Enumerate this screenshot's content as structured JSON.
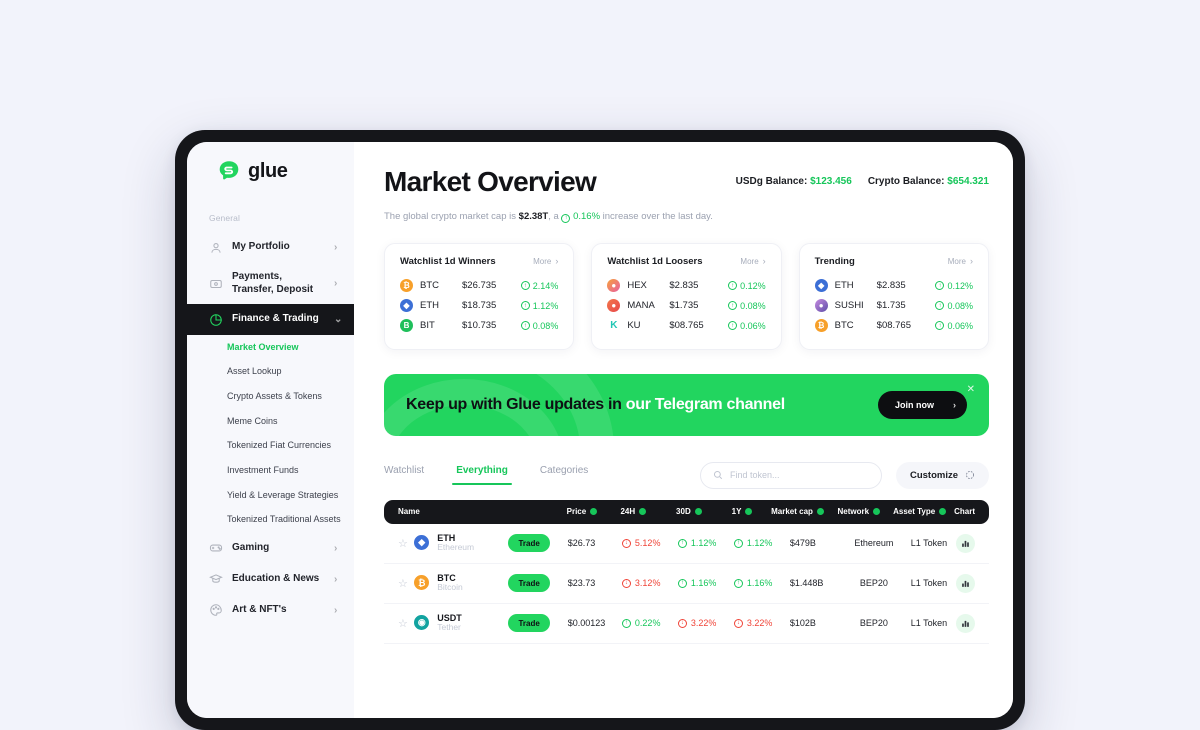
{
  "brand": {
    "name": "glue",
    "logo_icon": "glue-logo-icon"
  },
  "sidebar": {
    "section_label": "General",
    "items": [
      {
        "label": "My Portfolio",
        "icon": "user-icon",
        "chevron": "›",
        "active": false
      },
      {
        "label": "Payments, Transfer, Deposit",
        "icon": "wallet-icon",
        "chevron": "›",
        "active": false
      },
      {
        "label": "Finance & Trading",
        "icon": "pie-chart-icon",
        "chevron": "⌄",
        "active": true
      },
      {
        "label": "Gaming",
        "icon": "gamepad-icon",
        "chevron": "›",
        "active": false
      },
      {
        "label": "Education & News",
        "icon": "graduation-cap-icon",
        "chevron": "›",
        "active": false
      },
      {
        "label": "Art & NFT's",
        "icon": "palette-icon",
        "chevron": "›",
        "active": false
      }
    ],
    "sub_items": [
      {
        "label": "Market Overview",
        "current": true
      },
      {
        "label": "Asset Lookup",
        "current": false
      },
      {
        "label": "Crypto Assets & Tokens",
        "current": false
      },
      {
        "label": "Meme Coins",
        "current": false
      },
      {
        "label": "Tokenized Fiat Currencies",
        "current": false
      },
      {
        "label": "Investment Funds",
        "current": false
      },
      {
        "label": "Yield & Leverage Strategies",
        "current": false
      },
      {
        "label": "Tokenized Traditional Assets",
        "current": false
      }
    ]
  },
  "header": {
    "title": "Market Overview",
    "usdg_label": "USDg Balance:",
    "usdg_value": "$123.456",
    "crypto_label": "Crypto Balance:",
    "crypto_value": "$654.321",
    "subtitle_pre": "The global crypto market cap is ",
    "subtitle_cap": "$2.38T",
    "subtitle_mid": ", a ",
    "subtitle_pct": "0.16%",
    "subtitle_post": " increase over the last day."
  },
  "cards": [
    {
      "title": "Watchlist 1d Winners",
      "more": "More",
      "rows": [
        {
          "symbol": "BTC",
          "price": "$26.735",
          "change": "2.14%",
          "dir": "up",
          "color": "#f7a02a",
          "glyph": "₿"
        },
        {
          "symbol": "ETH",
          "price": "$18.735",
          "change": "1.12%",
          "dir": "up",
          "color": "#3c6fd6",
          "glyph": "◆"
        },
        {
          "symbol": "BIT",
          "price": "$10.735",
          "change": "0.08%",
          "dir": "up",
          "color": "#1fbf5b",
          "glyph": "B"
        }
      ]
    },
    {
      "title": "Watchlist 1d Loosers",
      "more": "More",
      "rows": [
        {
          "symbol": "HEX",
          "price": "$2.835",
          "change": "0.12%",
          "dir": "up",
          "color": "#e85fa0",
          "glyph": "●"
        },
        {
          "symbol": "MANA",
          "price": "$1.735",
          "change": "0.08%",
          "dir": "up",
          "color": "#f0574b",
          "glyph": "●"
        },
        {
          "symbol": "KU",
          "price": "$08.765",
          "change": "0.06%",
          "dir": "up",
          "color": "#21c6b4",
          "glyph": "K"
        }
      ]
    },
    {
      "title": "Trending",
      "more": "More",
      "rows": [
        {
          "symbol": "ETH",
          "price": "$2.835",
          "change": "0.12%",
          "dir": "up",
          "color": "#3c6fd6",
          "glyph": "◆"
        },
        {
          "symbol": "SUSHI",
          "price": "$1.735",
          "change": "0.08%",
          "dir": "up",
          "color": "#9a6ad4",
          "glyph": "●"
        },
        {
          "symbol": "BTC",
          "price": "$08.765",
          "change": "0.06%",
          "dir": "up",
          "color": "#f7a02a",
          "glyph": "₿"
        }
      ]
    }
  ],
  "banner": {
    "text_dark": "Keep up with Glue updates in",
    "text_light": "our Telegram channel",
    "cta": "Join now",
    "cta_chevron": "›",
    "close_icon": "close-icon",
    "bg_color": "#22d55f"
  },
  "tabs": [
    {
      "label": "Watchlist",
      "active": false
    },
    {
      "label": "Everything",
      "active": true
    },
    {
      "label": "Categories",
      "active": false
    }
  ],
  "search": {
    "placeholder": "Find token...",
    "value": "",
    "icon": "search-icon"
  },
  "customize": {
    "label": "Customize",
    "icon": "sliders-icon"
  },
  "table": {
    "columns": [
      {
        "label": "Name",
        "sortable": false
      },
      {
        "label": "Price",
        "sortable": true
      },
      {
        "label": "24H",
        "sortable": true
      },
      {
        "label": "30D",
        "sortable": true
      },
      {
        "label": "1Y",
        "sortable": true
      },
      {
        "label": "Market cap",
        "sortable": true
      },
      {
        "label": "Network",
        "sortable": true
      },
      {
        "label": "Asset Type",
        "sortable": true
      },
      {
        "label": "Chart",
        "sortable": false
      }
    ],
    "trade_label": "Trade",
    "rows": [
      {
        "symbol": "ETH",
        "name": "Ethereum",
        "color": "#3c6fd6",
        "glyph": "◆",
        "price": "$26.73",
        "h24": "5.12%",
        "h24_dir": "down",
        "d30": "1.12%",
        "d30_dir": "up",
        "y1": "1.12%",
        "y1_dir": "up",
        "mcap": "$479B",
        "network": "Ethereum",
        "asset_type": "L1 Token"
      },
      {
        "symbol": "BTC",
        "name": "Bitcoin",
        "color": "#f7a02a",
        "glyph": "₿",
        "price": "$23.73",
        "h24": "3.12%",
        "h24_dir": "down",
        "d30": "1.16%",
        "d30_dir": "up",
        "y1": "1.16%",
        "y1_dir": "up",
        "mcap": "$1.448B",
        "network": "BEP20",
        "asset_type": "L1 Token"
      },
      {
        "symbol": "USDT",
        "name": "Tether",
        "color": "#12a3a0",
        "glyph": "◉",
        "price": "$0.00123",
        "h24": "0.22%",
        "h24_dir": "up",
        "d30": "3.22%",
        "d30_dir": "down",
        "y1": "3.22%",
        "y1_dir": "down",
        "mcap": "$102B",
        "network": "BEP20",
        "asset_type": "L1 Token"
      }
    ]
  },
  "colors": {
    "accent": "#16c65a",
    "banner": "#22d55f",
    "danger": "#f04438",
    "dark": "#15161a"
  }
}
